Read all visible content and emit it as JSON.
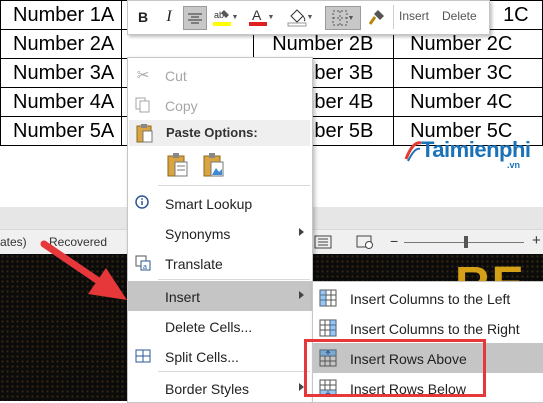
{
  "table": {
    "rows": [
      [
        "Number 1A",
        "",
        "",
        "1C"
      ],
      [
        "Number 2A",
        "",
        "Number 2B",
        "Number 2C"
      ],
      [
        "Number 3A",
        "",
        "Number 3B",
        "Number 3C"
      ],
      [
        "Number 4A",
        "",
        "Number 4B",
        "Number 4C"
      ],
      [
        "Number 5A",
        "",
        "Number 5B",
        "Number 5C"
      ]
    ]
  },
  "mini_toolbar": {
    "bold": "B",
    "italic": "I",
    "insert_label": "Insert",
    "delete_label": "Delete"
  },
  "status_bar": {
    "left_text": "ates)",
    "recovered": "Recovered"
  },
  "background_word": "RE",
  "context_menu": {
    "cut": "Cut",
    "copy": "Copy",
    "paste_options": "Paste Options:",
    "smart_lookup": "Smart Lookup",
    "synonyms": "Synonyms",
    "translate": "Translate",
    "insert": "Insert",
    "delete_cells": "Delete Cells...",
    "split_cells": "Split Cells...",
    "border_styles": "Border Styles"
  },
  "insert_submenu": {
    "cols_left": "Insert Columns to the Left",
    "cols_right": "Insert Columns to the Right",
    "rows_above": "Insert Rows Above",
    "rows_below": "Insert Rows Below"
  },
  "watermark": {
    "text": "Taimienphi",
    "suffix": ".vn"
  },
  "colors": {
    "highlight_red": "#e6373b",
    "menu_hover": "#c5c5c5",
    "font_color_bar": "#e02020",
    "highlight_yellow": "#ffff00",
    "watermark_blue": "#1a73b8"
  }
}
